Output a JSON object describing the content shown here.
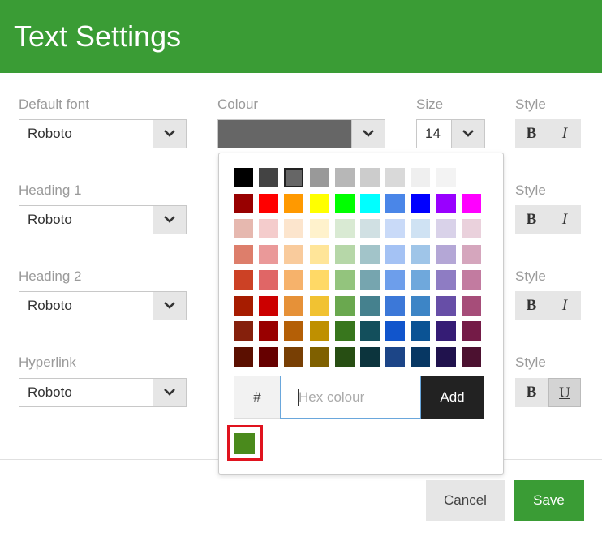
{
  "header": {
    "title": "Text Settings",
    "bg": "#3a9c35"
  },
  "rows": [
    {
      "label": "Default font",
      "font": "Roboto",
      "style_label": "Style",
      "styles": [
        "B",
        "I"
      ]
    },
    {
      "label": "Heading 1",
      "font": "Roboto",
      "style_label": "Style",
      "styles": [
        "B",
        "I"
      ]
    },
    {
      "label": "Heading 2",
      "font": "Roboto",
      "style_label": "Style",
      "styles": [
        "B",
        "I"
      ]
    },
    {
      "label": "Hyperlink",
      "font": "Roboto",
      "style_label": "Style",
      "styles": [
        "B",
        "U"
      ]
    }
  ],
  "colour": {
    "label": "Colour",
    "current": "#666666"
  },
  "size": {
    "label": "Size",
    "value": "14"
  },
  "palette": {
    "rows": [
      [
        "#000000",
        "#434343",
        "#666666",
        "#999999",
        "#b7b7b7",
        "#cccccc",
        "#d9d9d9",
        "#efefef",
        "#f3f3f3"
      ],
      [
        "#980000",
        "#ff0000",
        "#ff9900",
        "#ffff00",
        "#00ff00",
        "#00ffff",
        "#4a86e8",
        "#0000ff",
        "#9900ff",
        "#ff00ff"
      ],
      [
        "#e6b8af",
        "#f4cccc",
        "#fce5cd",
        "#fff2cc",
        "#d9ead3",
        "#d0e0e3",
        "#c9daf8",
        "#cfe2f3",
        "#d9d2e9",
        "#ead1dc"
      ],
      [
        "#dd7e6b",
        "#ea9999",
        "#f9cb9c",
        "#ffe599",
        "#b6d7a8",
        "#a2c4c9",
        "#a4c2f4",
        "#9fc5e8",
        "#b4a7d6",
        "#d5a6bd"
      ],
      [
        "#cc4125",
        "#e06666",
        "#f6b26b",
        "#ffd966",
        "#93c47d",
        "#76a5af",
        "#6d9eeb",
        "#6fa8dc",
        "#8e7cc3",
        "#c27ba0"
      ],
      [
        "#a61c00",
        "#cc0000",
        "#e69138",
        "#f1c232",
        "#6aa84f",
        "#45818e",
        "#3c78d8",
        "#3d85c6",
        "#674ea7",
        "#a64d79"
      ],
      [
        "#85200c",
        "#990000",
        "#b45f06",
        "#bf9000",
        "#38761d",
        "#134f5c",
        "#1155cc",
        "#0b5394",
        "#351c75",
        "#741b47"
      ],
      [
        "#5b0f00",
        "#660000",
        "#783f04",
        "#7f6000",
        "#274e13",
        "#0c343d",
        "#1c4587",
        "#073763",
        "#20124d",
        "#4c1130"
      ]
    ],
    "selected": "#666666",
    "hash": "#",
    "hex_placeholder": "Hex colour",
    "add_label": "Add",
    "custom_colours": [
      "#4a8a1c"
    ]
  },
  "footer": {
    "cancel_label": "Cancel",
    "save_label": "Save",
    "save_bg": "#3a9c35"
  }
}
